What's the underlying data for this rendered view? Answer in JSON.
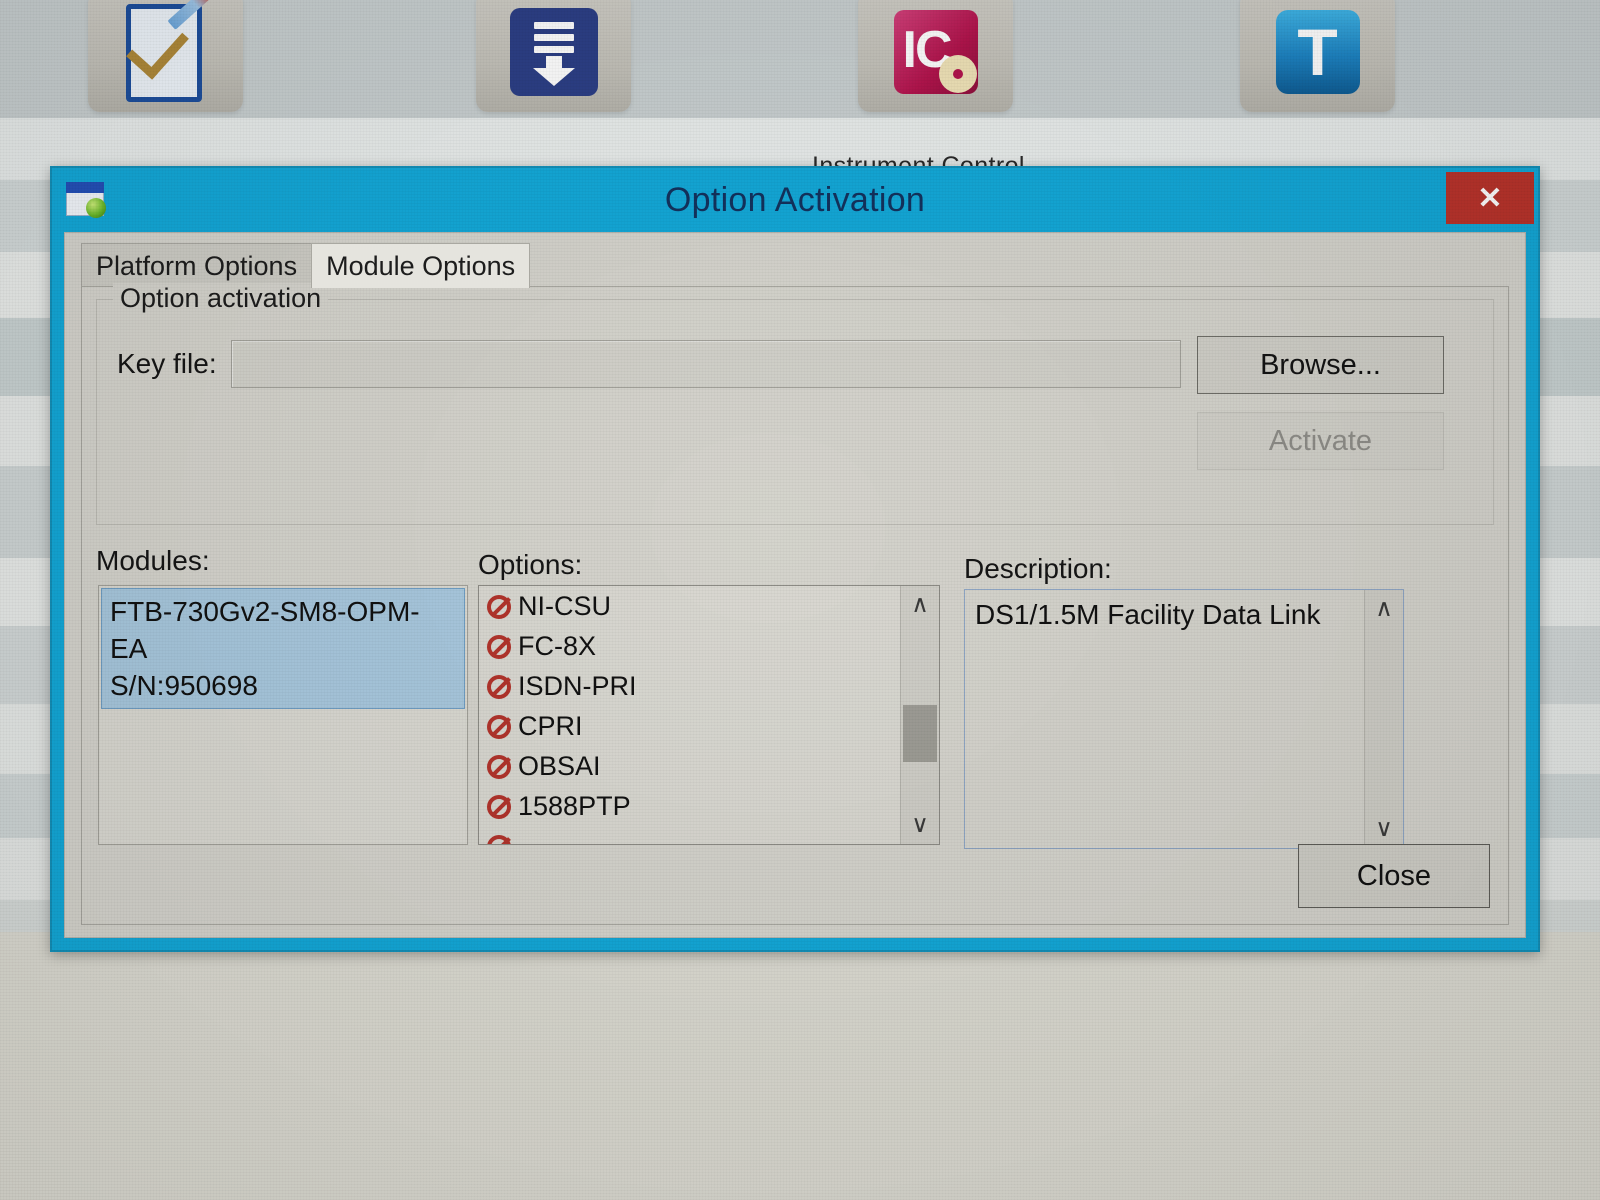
{
  "background": {
    "app_label": "Instrument Control",
    "toolbar_icons": [
      {
        "name": "checklist-pencil-icon",
        "label": ""
      },
      {
        "name": "download-update-icon",
        "label": ""
      },
      {
        "name": "instrument-control-icon",
        "label": "IC"
      },
      {
        "name": "toolbox-t-icon",
        "label": "T"
      }
    ]
  },
  "dialog": {
    "title": "Option Activation",
    "window_icon": "option-activation-window-icon",
    "close_label": "✕",
    "tabs": [
      {
        "label": "Platform Options",
        "active": false
      },
      {
        "label": "Module Options",
        "active": true
      }
    ],
    "group": {
      "legend": "Option activation",
      "keyfile_label": "Key file:",
      "keyfile_value": "",
      "keyfile_placeholder": "",
      "browse_label": "Browse...",
      "activate_label": "Activate",
      "activate_enabled": false
    },
    "modules": {
      "label": "Modules:",
      "items": [
        {
          "line1": "FTB-730Gv2-SM8-OPM-EA",
          "line2": "S/N:950698",
          "selected": true
        }
      ]
    },
    "options": {
      "label": "Options:",
      "items": [
        {
          "name": "NI-CSU",
          "state": "not-activated"
        },
        {
          "name": "FC-8X",
          "state": "not-activated"
        },
        {
          "name": "ISDN-PRI",
          "state": "not-activated"
        },
        {
          "name": "CPRI",
          "state": "not-activated"
        },
        {
          "name": "OBSAI",
          "state": "not-activated"
        },
        {
          "name": "1588PTP",
          "state": "not-activated"
        }
      ],
      "scrollbar": {
        "up_glyph": "∧",
        "down_glyph": "∨",
        "thumb_top_pct": 45,
        "thumb_height_pct": 16
      }
    },
    "description": {
      "label": "Description:",
      "text": "DS1/1.5M Facility Data Link",
      "scrollbar": {
        "up_glyph": "∧",
        "down_glyph": "∨"
      }
    },
    "close_button_label": "Close"
  },
  "colors": {
    "title_bar": "#13a8d8",
    "title_text": "#13325e",
    "close_button": "#b9332b",
    "dialog_face": "#d5d4cd",
    "selection": "#a8c8de",
    "disabled_text": "#8f8e89",
    "option_denied": "#b3342c"
  }
}
